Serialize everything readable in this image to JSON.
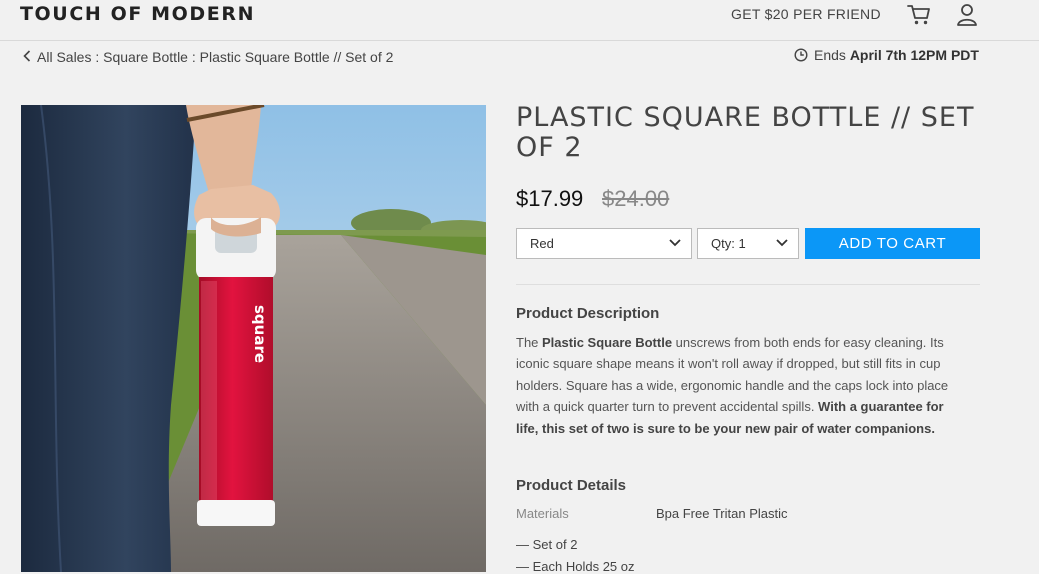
{
  "header": {
    "brand": "TOUCH OF MODERN",
    "referral": "GET $20 PER FRIEND",
    "cart_icon": "cart-icon",
    "user_icon": "user-icon"
  },
  "breadcrumb": {
    "icon": "chevron-left-icon",
    "text": "All Sales : Square Bottle : Plastic Square Bottle // Set of 2"
  },
  "sale_end": {
    "icon": "clock-icon",
    "prefix": "Ends",
    "date": "April 7th 12PM PDT"
  },
  "product": {
    "title": "PLASTIC SQUARE BOTTLE // SET OF 2",
    "price": "$17.99",
    "original_price": "$24.00",
    "color_select": "Red",
    "qty_select": "Qty: 1",
    "add_to_cart": "ADD TO CART",
    "bottle_logo": "square",
    "colors": {
      "accent": "#0b97f7",
      "bottle": "#c8102e"
    }
  },
  "description": {
    "heading": "Product Description",
    "p1": "The ",
    "p2": "Plastic Square Bottle",
    "p3": " unscrews from both ends for easy cleaning. Its iconic square shape means it won't roll away if dropped, but still fits in cup holders. Square has a wide, ergonomic handle and the caps lock into place with a quick quarter turn to prevent accidental spills. ",
    "p4": "With a guarantee for life, this set of two is sure to be your new pair of water companions."
  },
  "details": {
    "heading": "Product Details",
    "materials_label": "Materials",
    "materials_value": "Bpa Free Tritan Plastic",
    "bullets": [
      "— Set of 2",
      "— Each Holds 25 oz"
    ]
  }
}
